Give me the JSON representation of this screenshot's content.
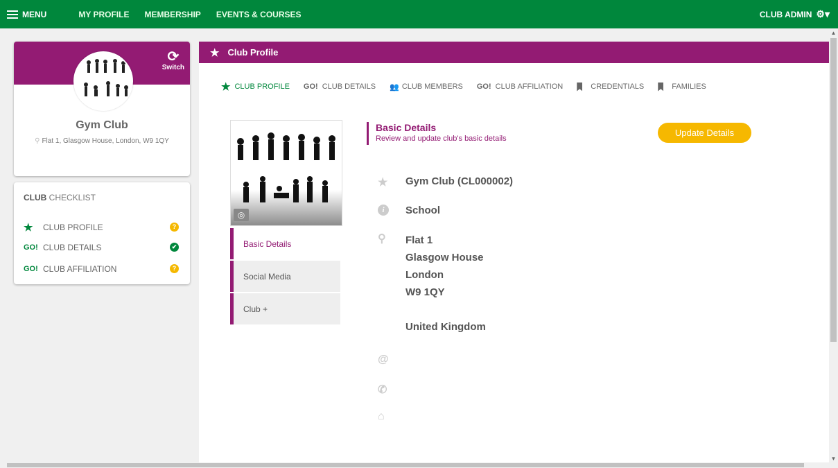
{
  "topnav": {
    "menu_label": "MENU",
    "links": [
      "MY PROFILE",
      "MEMBERSHIP",
      "EVENTS & COURSES"
    ],
    "admin_label": "CLUB ADMIN"
  },
  "club_card": {
    "switch_label": "Switch",
    "name": "Gym Club",
    "address": "Flat 1, Glasgow House, London, W9 1QY"
  },
  "checklist": {
    "title_bold": "CLUB",
    "title_rest": " CHECKLIST",
    "items": [
      {
        "icon": "★",
        "label": "CLUB PROFILE",
        "status": "?"
      },
      {
        "icon": "GO!",
        "label": "CLUB DETAILS",
        "status": "✔"
      },
      {
        "icon": "GO!",
        "label": "CLUB AFFILIATION",
        "status": "?"
      }
    ]
  },
  "main": {
    "header_title": "Club Profile",
    "tabs": [
      {
        "label": "CLUB PROFILE"
      },
      {
        "icon": "GO!",
        "label": "CLUB DETAILS"
      },
      {
        "label": "CLUB MEMBERS"
      },
      {
        "icon": "GO!",
        "label": "CLUB AFFILIATION"
      },
      {
        "label": "CREDENTIALS"
      },
      {
        "label": "FAMILIES"
      }
    ],
    "subnav": [
      "Basic Details",
      "Social Media",
      "Club +"
    ],
    "details_title": "Basic Details",
    "details_subtitle": "Review and update club's basic details",
    "update_button": "Update Details",
    "club_name_id": "Gym Club (CL000002)",
    "club_type": "School",
    "address_lines": [
      "Flat 1",
      "Glasgow House",
      "London",
      "W9 1QY",
      "",
      "United Kingdom"
    ]
  },
  "colors": {
    "brand_green": "#00873c",
    "brand_purple": "#931b73",
    "accent_yellow": "#f6b800"
  }
}
